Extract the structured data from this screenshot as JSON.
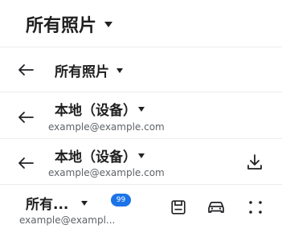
{
  "bar1": {
    "title": "所有照片"
  },
  "bar2": {
    "title": "所有照片"
  },
  "bar3": {
    "title": "本地（设备）",
    "subtitle": "example@example.com"
  },
  "bar4": {
    "title": "本地（设备）",
    "subtitle": "example@example.com"
  },
  "bar5": {
    "title": "所有...",
    "badge": "99",
    "subtitle": "example@exampl..."
  },
  "icons": {
    "back": "arrow-left-icon",
    "caret": "caret-down-icon",
    "download": "download-icon",
    "save": "floppy-disk-icon",
    "car": "car-icon",
    "more": "four-dots-icon"
  },
  "colors": {
    "badge": "#1a73e8",
    "separator": "#ececec"
  }
}
